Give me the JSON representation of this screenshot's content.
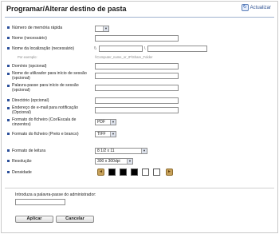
{
  "header": {
    "title": "Programar/Alterar destino de pasta",
    "refresh_label": "Actualizar"
  },
  "fields": {
    "quick_dial": {
      "label": "Número de memória rápida"
    },
    "name_required": {
      "label": "Nome (necessário)"
    },
    "location_name": {
      "label": "Nome da localização (necessário)",
      "prefix": "\\\\",
      "separator": "\\",
      "example_label": "Por exemplo:",
      "example_path": "\\\\Computer_name_or_IP\\Share_Folder"
    },
    "domain": {
      "label": "Domínio (opcional)"
    },
    "login_user": {
      "label": "Nome de utilizador para início de sessão (opcional)"
    },
    "login_password": {
      "label": "Palavra-passe para início de sessão (opcional)"
    },
    "directory": {
      "label": "Directório (opcional)"
    },
    "notify_email": {
      "label": "Endereço de e-mail para notificação (Opcional)"
    },
    "file_format_color": {
      "label": "Formato do ficheiro (Cor/Escala de cinzentos)",
      "value": "PDF"
    },
    "file_format_bw": {
      "label": "Formato do ficheiro (Preto e branco)",
      "value": "TIFF"
    },
    "scan_size": {
      "label": "Formato de leitura",
      "value": "8 1/2 x 11"
    },
    "resolution": {
      "label": "Resolução",
      "value": "300 x 300dpi"
    },
    "density": {
      "label": "Densidade",
      "levels": 7,
      "selected": 1
    }
  },
  "admin": {
    "label": "Introduza a palavra-passe do administrador:"
  },
  "buttons": {
    "apply": "Aplicar",
    "cancel": "Cancelar"
  }
}
